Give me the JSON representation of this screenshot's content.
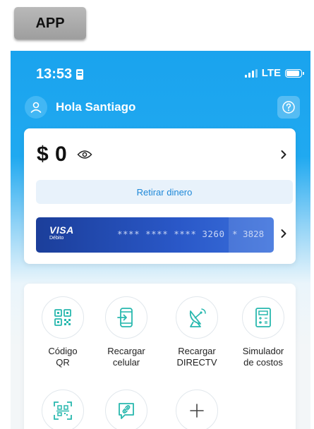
{
  "tag": {
    "label": "APP"
  },
  "status_bar": {
    "time": "13:53",
    "network": "LTE"
  },
  "header": {
    "greeting": "Hola Santiago"
  },
  "balance": {
    "amount": "$ 0"
  },
  "withdraw": {
    "label": "Retirar dinero"
  },
  "card": {
    "brand": "VISA",
    "type": "Débito",
    "number": "**** **** **** 3260",
    "number_extra": "* 3828"
  },
  "services": [
    {
      "label_1": "Código",
      "label_2": "QR",
      "icon": "qr-code-icon"
    },
    {
      "label_1": "Recargar",
      "label_2": "celular",
      "icon": "phone-recharge-icon"
    },
    {
      "label_1": "Recargar",
      "label_2": "DIRECTV",
      "icon": "satellite-dish-icon"
    },
    {
      "label_1": "Simulador",
      "label_2": "de costos",
      "icon": "calculator-icon"
    },
    {
      "label_1": "",
      "label_2": "",
      "icon": "qr-scan-icon"
    },
    {
      "label_1": "",
      "label_2": "",
      "icon": "link-message-icon"
    },
    {
      "label_1": "",
      "label_2": "",
      "icon": "plus-icon"
    }
  ],
  "colors": {
    "primary": "#1aa3ee",
    "accent_blue": "#1e88d8",
    "card_blue": "#1b3e9a",
    "icon_teal": "#28b8ae"
  }
}
